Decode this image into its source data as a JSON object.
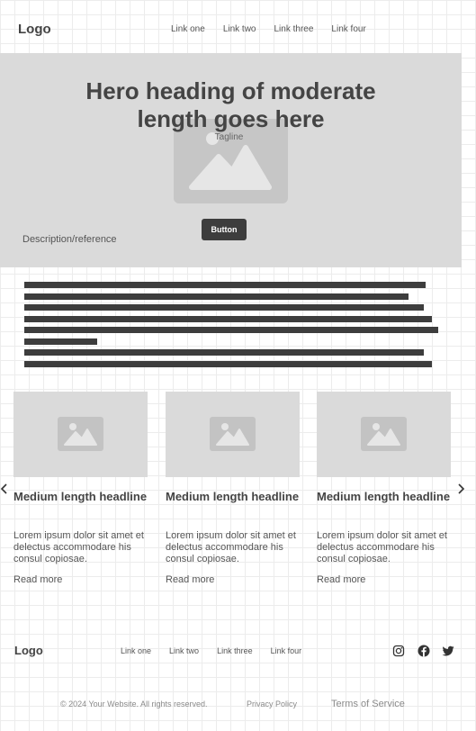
{
  "header": {
    "logo": "Logo",
    "nav": [
      "Link one",
      "Link two",
      "Link three",
      "Link four"
    ]
  },
  "hero": {
    "heading": "Hero heading of moderate length goes here",
    "tagline": "Tagline",
    "button": "Button",
    "description": "Description/reference"
  },
  "cards": [
    {
      "headline": "Medium length headline",
      "body": "Lorem ipsum dolor sit amet et delectus accommodare his consul copiosae.",
      "link": "Read more"
    },
    {
      "headline": "Medium length headline",
      "body": "Lorem ipsum dolor sit amet et delectus accommodare his consul copiosae.",
      "link": "Read more"
    },
    {
      "headline": "Medium length headline",
      "body": "Lorem ipsum dolor sit amet et delectus accommodare his consul copiosae.",
      "link": "Read more"
    }
  ],
  "carousel": {
    "prev_icon": "chevron-left-icon",
    "next_icon": "chevron-right-icon"
  },
  "footer": {
    "logo": "Logo",
    "nav": [
      "Link one",
      "Link two",
      "Link three",
      "Link four"
    ],
    "social_icons": [
      "instagram-icon",
      "facebook-icon",
      "twitter-icon"
    ],
    "copyright": "© 2024 Your Website. All rights reserved.",
    "privacy": "Privacy Policy",
    "terms": "Terms of Service"
  },
  "colors": {
    "placeholder": "#dadada",
    "dark": "#3d3d3d",
    "text": "#444444"
  }
}
